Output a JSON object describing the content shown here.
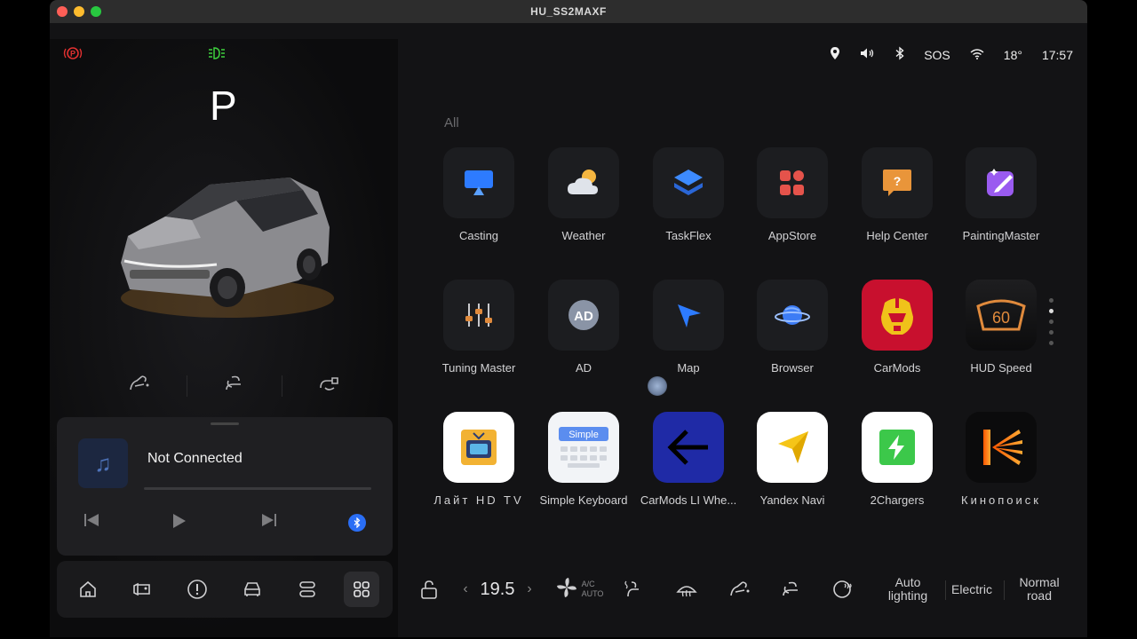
{
  "window": {
    "title": "HU_SS2MAXF"
  },
  "status": {
    "sos": "SOS",
    "temperature": "18°",
    "time": "17:57",
    "icons": [
      "parking-brake-icon",
      "high-beam-icon",
      "location-icon",
      "volume-icon",
      "bluetooth-icon",
      "wifi-icon"
    ]
  },
  "vehicle": {
    "gear": "P"
  },
  "media": {
    "track": "Not Connected"
  },
  "launcher": {
    "section_label": "All",
    "apps": [
      {
        "label": "Casting"
      },
      {
        "label": "Weather"
      },
      {
        "label": "TaskFlex"
      },
      {
        "label": "AppStore"
      },
      {
        "label": "Help Center"
      },
      {
        "label": "PaintingMaster"
      },
      {
        "label": "Tuning Master"
      },
      {
        "label": "AD"
      },
      {
        "label": "Map"
      },
      {
        "label": "Browser"
      },
      {
        "label": "CarMods"
      },
      {
        "label": "HUD Speed"
      },
      {
        "label": "Лайт HD TV"
      },
      {
        "label": "Simple Keyboard"
      },
      {
        "label": "CarMods LI Whe..."
      },
      {
        "label": "Yandex Navi"
      },
      {
        "label": "2Chargers"
      },
      {
        "label": "Кинопоиск"
      }
    ],
    "icon_text": {
      "ad": "AD",
      "hud": "60",
      "simple": "Simple"
    }
  },
  "climate": {
    "temperature": "19.5",
    "ac_line1": "A/C",
    "ac_line2": "AUTO",
    "lighting": "Auto lighting",
    "mode": "Electric",
    "road": "Normal road"
  },
  "colors": {
    "accent_blue": "#2a6ef5",
    "background": "#131315",
    "carmods_red": "#c8102e"
  }
}
